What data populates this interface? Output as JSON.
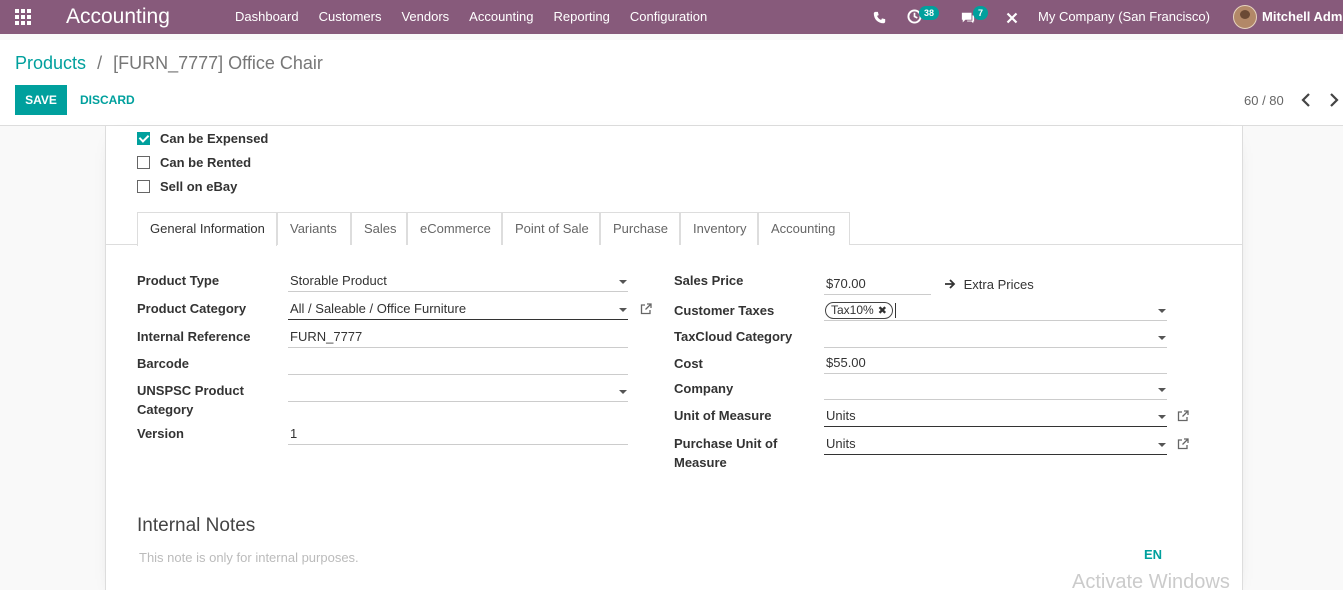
{
  "navbar": {
    "brand": "Accounting",
    "menu": [
      "Dashboard",
      "Customers",
      "Vendors",
      "Accounting",
      "Reporting",
      "Configuration"
    ],
    "activities_count": "38",
    "messages_count": "7",
    "company": "My Company (San Francisco)",
    "user": "Mitchell Admi",
    "icons": [
      "apps-grid-icon",
      "phone-icon",
      "clock-icon",
      "chat-icon",
      "close-icon"
    ]
  },
  "breadcrumb": {
    "parent": "Products",
    "separator": "/",
    "current": "[FURN_7777] Office Chair"
  },
  "actions": {
    "save": "SAVE",
    "discard": "DISCARD"
  },
  "pager": {
    "value": "60 / 80"
  },
  "checkboxes": [
    {
      "label": "Can be Expensed",
      "checked": true
    },
    {
      "label": "Can be Rented",
      "checked": false
    },
    {
      "label": "Sell on eBay",
      "checked": false
    }
  ],
  "tabs": [
    "General Information",
    "Variants",
    "Sales",
    "eCommerce",
    "Point of Sale",
    "Purchase",
    "Inventory",
    "Accounting"
  ],
  "active_tab": "General Information",
  "left_fields": {
    "product_type": {
      "label": "Product Type",
      "value": "Storable Product"
    },
    "product_category": {
      "label": "Product Category",
      "value": "All / Saleable / Office Furniture"
    },
    "internal_reference": {
      "label": "Internal Reference",
      "value": "FURN_7777"
    },
    "barcode": {
      "label": "Barcode",
      "value": ""
    },
    "unspsc": {
      "label_line1": "UNSPSC Product",
      "label_line2": "Category",
      "value": ""
    },
    "version": {
      "label": "Version",
      "value": "1"
    }
  },
  "right_fields": {
    "sales_price": {
      "label": "Sales Price",
      "value": "$70.00",
      "extra": "Extra Prices"
    },
    "customer_taxes": {
      "label": "Customer Taxes",
      "tag": "Tax10%"
    },
    "taxcloud": {
      "label": "TaxCloud Category",
      "value": ""
    },
    "cost": {
      "label": "Cost",
      "value": "$55.00"
    },
    "company": {
      "label": "Company",
      "value": ""
    },
    "uom": {
      "label": "Unit of Measure",
      "value": "Units"
    },
    "purchase_uom": {
      "label_line1": "Purchase Unit of",
      "label_line2": "Measure",
      "value": "Units"
    }
  },
  "notes": {
    "title": "Internal Notes",
    "placeholder": "This note is only for internal purposes.",
    "lang": "EN"
  },
  "watermark": "Activate Windows",
  "colors": {
    "navbar": "#875a7b",
    "accent": "#00a09d"
  }
}
